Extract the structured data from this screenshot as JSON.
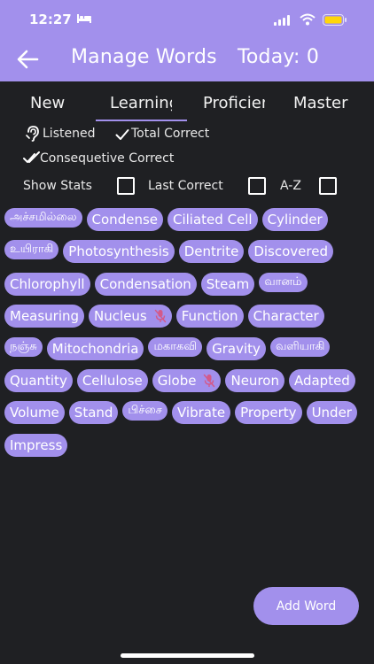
{
  "status_bar": {
    "time": "12:27"
  },
  "header": {
    "title": "Manage Words",
    "today": "Today: 0"
  },
  "tabs": [
    {
      "label": "New"
    },
    {
      "label": "Learning"
    },
    {
      "label": "Proficient"
    },
    {
      "label": "Master"
    }
  ],
  "legend": {
    "listened": "Listened",
    "total_correct": "Total Correct",
    "consequetive_correct": "Consequetive Correct"
  },
  "options": {
    "show_stats": "Show Stats",
    "last_correct": "Last Correct",
    "az": "A-Z"
  },
  "words": [
    {
      "text": "அச்சமில்லை"
    },
    {
      "text": "Condense"
    },
    {
      "text": "Ciliated Cell"
    },
    {
      "text": "Cylinder"
    },
    {
      "text": "உயிராகி"
    },
    {
      "text": "Photosynthesis"
    },
    {
      "text": "Dentrite"
    },
    {
      "text": "Discovered"
    },
    {
      "text": "Chlorophyll"
    },
    {
      "text": "Condensation"
    },
    {
      "text": "Steam"
    },
    {
      "text": "வானம்"
    },
    {
      "text": "Measuring"
    },
    {
      "text": "Nucleus",
      "muted": true
    },
    {
      "text": "Function"
    },
    {
      "text": "Character"
    },
    {
      "text": "நஞ்சு"
    },
    {
      "text": "Mitochondria"
    },
    {
      "text": "மகாகவி"
    },
    {
      "text": "Gravity"
    },
    {
      "text": "வளியாகி"
    },
    {
      "text": "Quantity"
    },
    {
      "text": "Cellulose"
    },
    {
      "text": "Globe",
      "muted": true
    },
    {
      "text": "Neuron"
    },
    {
      "text": "Adapted"
    },
    {
      "text": "Volume"
    },
    {
      "text": "Stand"
    },
    {
      "text": "பிச்சை"
    },
    {
      "text": "Vibrate"
    },
    {
      "text": "Property"
    },
    {
      "text": "Under"
    },
    {
      "text": "Impress"
    }
  ],
  "add_word_label": "Add Word",
  "colors": {
    "accent": "#a290ec",
    "background": "#1f2023",
    "muted_mic": "#d35a8a"
  }
}
